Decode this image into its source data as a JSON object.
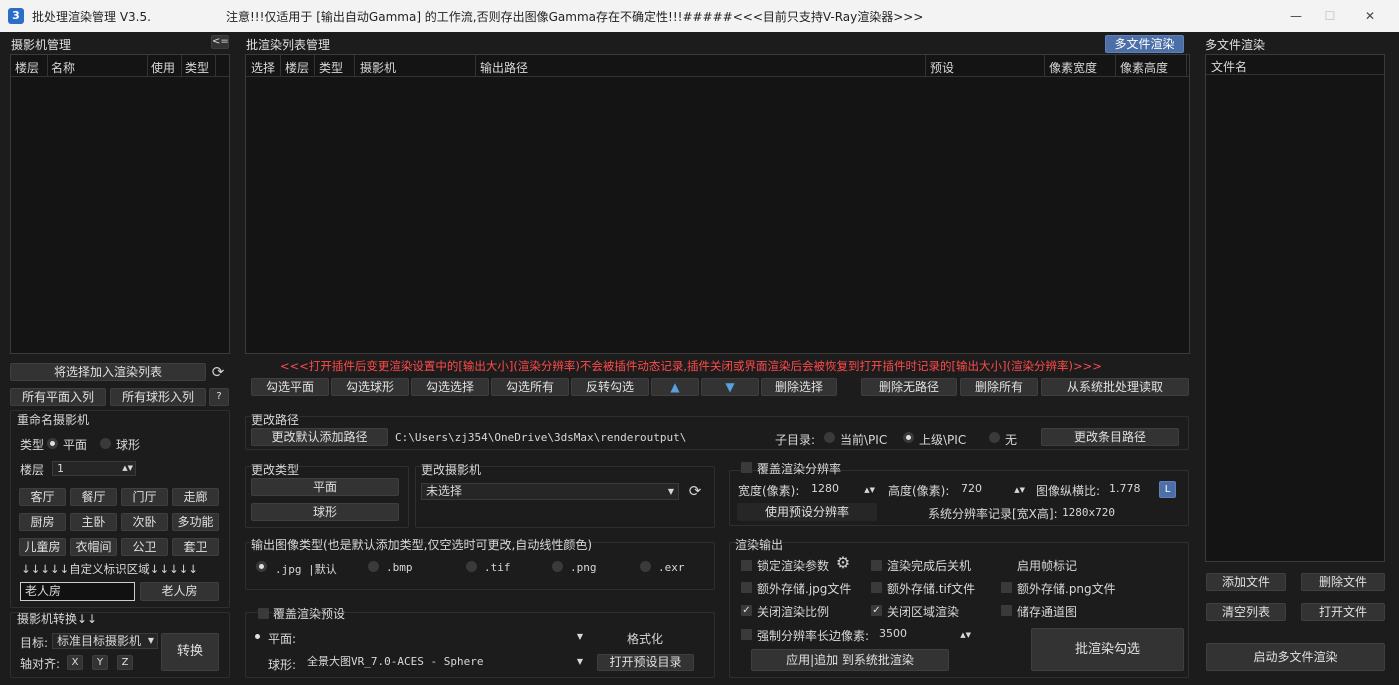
{
  "window": {
    "title": "批处理渲染管理 V3.5.",
    "warning": "注意!!!仅适用于 [输出自动Gamma] 的工作流,否则存出图像Gamma存在不确定性!!!#####<<<目前只支持V-Ray渲染器>>>",
    "app_icon": "3"
  },
  "camera_panel": {
    "title": "摄影机管理",
    "collapse": "<=",
    "columns": [
      "楼层",
      "名称",
      "使用",
      "类型"
    ],
    "add_to_list": "将选择加入渲染列表",
    "all_plane": "所有平面入列",
    "all_sphere": "所有球形入列",
    "help": "?",
    "rename_title": "重命名摄影机",
    "type_label": "类型",
    "type_plane": "平面",
    "type_sphere": "球形",
    "floor_label": "楼层",
    "floor_value": "1",
    "rooms": [
      "客厅",
      "餐厅",
      "门厅",
      "走廊",
      "厨房",
      "主卧",
      "次卧",
      "多功能",
      "儿童房",
      "衣帽间",
      "公卫",
      "套卫"
    ],
    "custom_area": "↓↓↓↓↓自定义标识区域↓↓↓↓↓",
    "custom_input": "老人房",
    "custom_button": "老人房",
    "convert_title": "摄影机转换↓↓",
    "target_label": "目标:",
    "target_value": "标准目标摄影机",
    "align_label": "轴对齐:",
    "axes": [
      "X",
      "Y",
      "Z"
    ],
    "convert_button": "转换"
  },
  "batch_panel": {
    "title": "批渲染列表管理",
    "multi_render": "多文件渲染",
    "columns": [
      "选择",
      "楼层",
      "类型",
      "摄影机",
      "输出路径",
      "预设",
      "像素宽度",
      "像素高度"
    ],
    "notice": "<<<打开插件后变更渲染设置中的[输出大小](渲染分辨率)不会被插件动态记录,插件关闭或界面渲染后会被恢复到打开插件时记录的[输出大小](渲染分辨率)>>>",
    "buttons": [
      "勾选平面",
      "勾选球形",
      "勾选选择",
      "勾选所有",
      "反转勾选",
      "删除选择",
      "删除无路径",
      "删除所有",
      "从系统批处理读取"
    ],
    "up": "▲",
    "down": "▼"
  },
  "path_group": {
    "title": "更改路径",
    "button": "更改默认添加路径",
    "path": "C:\\Users\\zj354\\OneDrive\\3dsMax\\renderoutput\\",
    "subdir_label": "子目录:",
    "opt_current": "当前\\PIC",
    "opt_parent": "上级\\PIC",
    "opt_none": "无",
    "change_item": "更改条目路径"
  },
  "type_group": {
    "title": "更改类型",
    "plane": "平面",
    "sphere": "球形"
  },
  "camera_group": {
    "title": "更改摄影机",
    "value": "未选择"
  },
  "resolution_group": {
    "title": "覆盖渲染分辨率",
    "width_label": "宽度(像素):",
    "width_value": "1280",
    "height_label": "高度(像素):",
    "height_value": "720",
    "aspect_label": "图像纵横比:",
    "aspect_value": "1.778",
    "lock": "L",
    "use_preset": "使用预设分辨率",
    "system_record": "系统分辨率记录[宽X高]:",
    "system_value": "1280x720"
  },
  "image_type_group": {
    "title": "输出图像类型(也是默认添加类型,仅空选时可更改,自动线性颜色)",
    "types": [
      ".jpg |默认",
      ".bmp",
      ".tif",
      ".png",
      ".exr"
    ]
  },
  "preset_group": {
    "title": "覆盖渲染预设",
    "plane_label": "平面:",
    "plane_value": "",
    "format_button": "格式化",
    "sphere_label": "球形:",
    "sphere_value": "全景大图VR_7.0-ACES - Sphere",
    "open_dir": "打开预设目录"
  },
  "render_output_group": {
    "title": "渲染输出",
    "lock_params": "锁定渲染参数",
    "shutdown": "渲染完成后关机",
    "frame_mark": "启用帧标记",
    "save_jpg": "额外存储.jpg文件",
    "save_tif": "额外存储.tif文件",
    "save_png": "额外存储.png文件",
    "close_ratio": "关闭渲染比例",
    "close_region": "关闭区域渲染",
    "save_channels": "储存通道图",
    "force_long_edge": "强制分辨率长边像素:",
    "long_edge_value": "3500",
    "apply_button": "应用|追加 到系统批渲染",
    "batch_render": "批渲染勾选"
  },
  "multi_file_panel": {
    "title": "多文件渲染",
    "column": "文件名",
    "add_file": "添加文件",
    "delete_file": "删除文件",
    "clear_list": "清空列表",
    "open_file": "打开文件",
    "start": "启动多文件渲染"
  },
  "colors": {
    "background": "#1c1c1c",
    "panel": "#141414",
    "button": "#333333",
    "accent_blue": "#4c6fa8",
    "notice_red": "#ff4a4a"
  }
}
